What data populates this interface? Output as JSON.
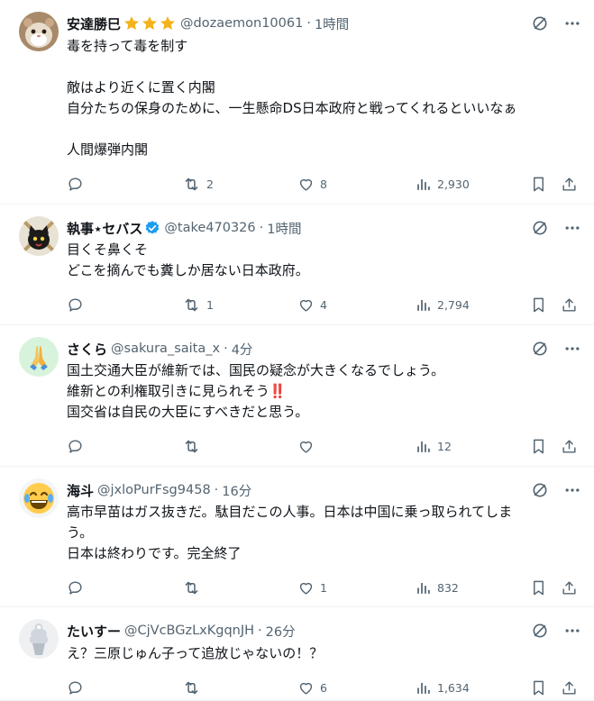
{
  "tweets": [
    {
      "name": "安達勝巳",
      "handle": "@dozaemon10061",
      "time": "1時間",
      "badges": [
        "star-icon",
        "star-icon",
        "star-icon"
      ],
      "avatar": "hamster-avatar",
      "lines": [
        "毒を持って毒を制す",
        "",
        "敵はより近くに置く内閣",
        "自分たちの保身のために、一生懸命DS日本政府と戦ってくれるといいなぁ",
        "",
        "人間爆弾内閣"
      ],
      "replies": "",
      "retweets": "2",
      "likes": "8",
      "views": "2,930"
    },
    {
      "name": "執事⋆セバス",
      "handle": "@take470326",
      "time": "1時間",
      "badges": [
        "verified-icon"
      ],
      "avatar": "black-cat-avatar",
      "lines": [
        "目くそ鼻くそ",
        "どこを摘んでも糞しか居ない日本政府。"
      ],
      "replies": "",
      "retweets": "1",
      "likes": "4",
      "views": "2,794"
    },
    {
      "name": "さくら",
      "handle": "@sakura_saita_x",
      "time": "4分",
      "badges": [],
      "avatar": "praying-hands-avatar",
      "lines": [
        "国土交通大臣が維新では、国民の疑念が大きくなるでしょう。",
        "維新との利権取引きに見られそう‼️",
        "国交省は自民の大臣にすべきだと思う。"
      ],
      "replies": "",
      "retweets": "",
      "likes": "",
      "views": "12"
    },
    {
      "name": "海斗",
      "handle": "@jxloPurFsg9458",
      "time": "16分",
      "badges": [],
      "avatar": "laughing-emoji-avatar",
      "lines": [
        "高市早苗はガス抜きだ。駄目だこの人事。日本は中国に乗っ取られてしま",
        "う。",
        "日本は終わりです。完全終了"
      ],
      "replies": "",
      "retweets": "",
      "likes": "1",
      "views": "832"
    },
    {
      "name": "たいすー",
      "handle": "@CjVcBGzLxKgqnJH",
      "time": "26分",
      "badges": [],
      "avatar": "soft-serve-avatar",
      "lines": [
        "え？三原じゅん子って追放じゃないの！？"
      ],
      "replies": "",
      "retweets": "",
      "likes": "6",
      "views": "1,634"
    }
  ],
  "icons": {
    "grok": "grok-icon",
    "more": "more-icon",
    "reply": "reply-icon",
    "retweet": "retweet-icon",
    "like": "like-icon",
    "views": "views-icon",
    "bookmark": "bookmark-icon",
    "share": "share-icon"
  },
  "colors": {
    "text": "#0f1419",
    "secondary": "#536471",
    "divider": "#eff3f4",
    "verified": "#1d9bf0",
    "star": "#f4b21b"
  }
}
